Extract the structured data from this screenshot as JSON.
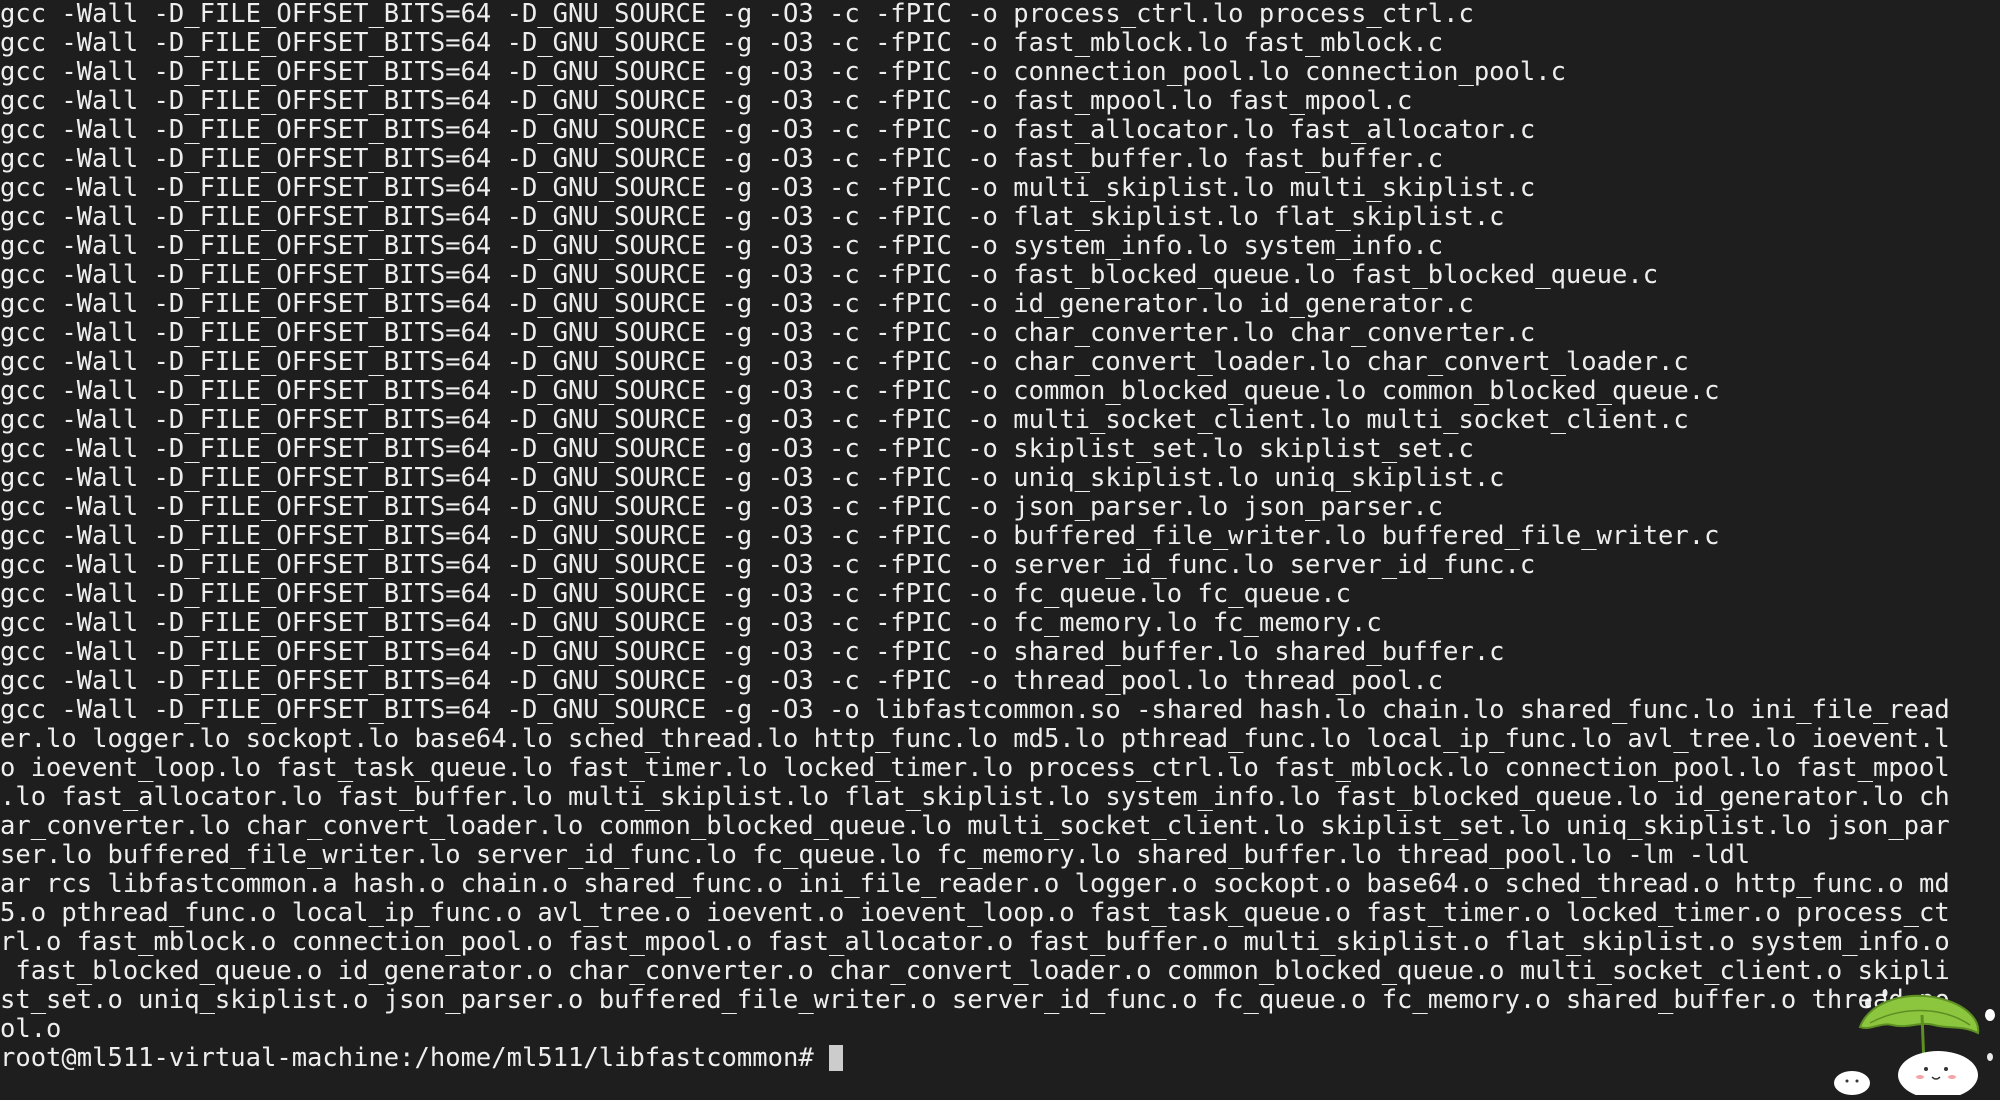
{
  "terminal": {
    "lines": [
      "gcc -Wall -D_FILE_OFFSET_BITS=64 -D_GNU_SOURCE -g -O3 -c -fPIC -o process_ctrl.lo process_ctrl.c",
      "gcc -Wall -D_FILE_OFFSET_BITS=64 -D_GNU_SOURCE -g -O3 -c -fPIC -o fast_mblock.lo fast_mblock.c",
      "gcc -Wall -D_FILE_OFFSET_BITS=64 -D_GNU_SOURCE -g -O3 -c -fPIC -o connection_pool.lo connection_pool.c",
      "gcc -Wall -D_FILE_OFFSET_BITS=64 -D_GNU_SOURCE -g -O3 -c -fPIC -o fast_mpool.lo fast_mpool.c",
      "gcc -Wall -D_FILE_OFFSET_BITS=64 -D_GNU_SOURCE -g -O3 -c -fPIC -o fast_allocator.lo fast_allocator.c",
      "gcc -Wall -D_FILE_OFFSET_BITS=64 -D_GNU_SOURCE -g -O3 -c -fPIC -o fast_buffer.lo fast_buffer.c",
      "gcc -Wall -D_FILE_OFFSET_BITS=64 -D_GNU_SOURCE -g -O3 -c -fPIC -o multi_skiplist.lo multi_skiplist.c",
      "gcc -Wall -D_FILE_OFFSET_BITS=64 -D_GNU_SOURCE -g -O3 -c -fPIC -o flat_skiplist.lo flat_skiplist.c",
      "gcc -Wall -D_FILE_OFFSET_BITS=64 -D_GNU_SOURCE -g -O3 -c -fPIC -o system_info.lo system_info.c",
      "gcc -Wall -D_FILE_OFFSET_BITS=64 -D_GNU_SOURCE -g -O3 -c -fPIC -o fast_blocked_queue.lo fast_blocked_queue.c",
      "gcc -Wall -D_FILE_OFFSET_BITS=64 -D_GNU_SOURCE -g -O3 -c -fPIC -o id_generator.lo id_generator.c",
      "gcc -Wall -D_FILE_OFFSET_BITS=64 -D_GNU_SOURCE -g -O3 -c -fPIC -o char_converter.lo char_converter.c",
      "gcc -Wall -D_FILE_OFFSET_BITS=64 -D_GNU_SOURCE -g -O3 -c -fPIC -o char_convert_loader.lo char_convert_loader.c",
      "gcc -Wall -D_FILE_OFFSET_BITS=64 -D_GNU_SOURCE -g -O3 -c -fPIC -o common_blocked_queue.lo common_blocked_queue.c",
      "gcc -Wall -D_FILE_OFFSET_BITS=64 -D_GNU_SOURCE -g -O3 -c -fPIC -o multi_socket_client.lo multi_socket_client.c",
      "gcc -Wall -D_FILE_OFFSET_BITS=64 -D_GNU_SOURCE -g -O3 -c -fPIC -o skiplist_set.lo skiplist_set.c",
      "gcc -Wall -D_FILE_OFFSET_BITS=64 -D_GNU_SOURCE -g -O3 -c -fPIC -o uniq_skiplist.lo uniq_skiplist.c",
      "gcc -Wall -D_FILE_OFFSET_BITS=64 -D_GNU_SOURCE -g -O3 -c -fPIC -o json_parser.lo json_parser.c",
      "gcc -Wall -D_FILE_OFFSET_BITS=64 -D_GNU_SOURCE -g -O3 -c -fPIC -o buffered_file_writer.lo buffered_file_writer.c",
      "gcc -Wall -D_FILE_OFFSET_BITS=64 -D_GNU_SOURCE -g -O3 -c -fPIC -o server_id_func.lo server_id_func.c",
      "gcc -Wall -D_FILE_OFFSET_BITS=64 -D_GNU_SOURCE -g -O3 -c -fPIC -o fc_queue.lo fc_queue.c",
      "gcc -Wall -D_FILE_OFFSET_BITS=64 -D_GNU_SOURCE -g -O3 -c -fPIC -o fc_memory.lo fc_memory.c",
      "gcc -Wall -D_FILE_OFFSET_BITS=64 -D_GNU_SOURCE -g -O3 -c -fPIC -o shared_buffer.lo shared_buffer.c",
      "gcc -Wall -D_FILE_OFFSET_BITS=64 -D_GNU_SOURCE -g -O3 -c -fPIC -o thread_pool.lo thread_pool.c",
      "gcc -Wall -D_FILE_OFFSET_BITS=64 -D_GNU_SOURCE -g -O3 -o libfastcommon.so -shared hash.lo chain.lo shared_func.lo ini_file_read",
      "er.lo logger.lo sockopt.lo base64.lo sched_thread.lo http_func.lo md5.lo pthread_func.lo local_ip_func.lo avl_tree.lo ioevent.l",
      "o ioevent_loop.lo fast_task_queue.lo fast_timer.lo locked_timer.lo process_ctrl.lo fast_mblock.lo connection_pool.lo fast_mpool",
      ".lo fast_allocator.lo fast_buffer.lo multi_skiplist.lo flat_skiplist.lo system_info.lo fast_blocked_queue.lo id_generator.lo ch",
      "ar_converter.lo char_convert_loader.lo common_blocked_queue.lo multi_socket_client.lo skiplist_set.lo uniq_skiplist.lo json_par",
      "ser.lo buffered_file_writer.lo server_id_func.lo fc_queue.lo fc_memory.lo shared_buffer.lo thread_pool.lo -lm -ldl",
      "ar rcs libfastcommon.a hash.o chain.o shared_func.o ini_file_reader.o logger.o sockopt.o base64.o sched_thread.o http_func.o md",
      "5.o pthread_func.o local_ip_func.o avl_tree.o ioevent.o ioevent_loop.o fast_task_queue.o fast_timer.o locked_timer.o process_ct",
      "rl.o fast_mblock.o connection_pool.o fast_mpool.o fast_allocator.o fast_buffer.o multi_skiplist.o flat_skiplist.o system_info.o",
      " fast_blocked_queue.o id_generator.o char_converter.o char_convert_loader.o common_blocked_queue.o multi_socket_client.o skipli",
      "st_set.o uniq_skiplist.o json_parser.o buffered_file_writer.o server_id_func.o fc_queue.o fc_memory.o shared_buffer.o thread_po",
      "ol.o"
    ],
    "prompt": "root@ml511-virtual-machine:/home/ml511/libfastcommon# "
  },
  "colors": {
    "background": "#1e1e1e",
    "foreground": "#eeeeee",
    "cursor": "#cccccc",
    "mascot_leaf": "#8cc63f"
  },
  "icons": {
    "mascot": "mascot-with-leaf-umbrella-icon"
  }
}
